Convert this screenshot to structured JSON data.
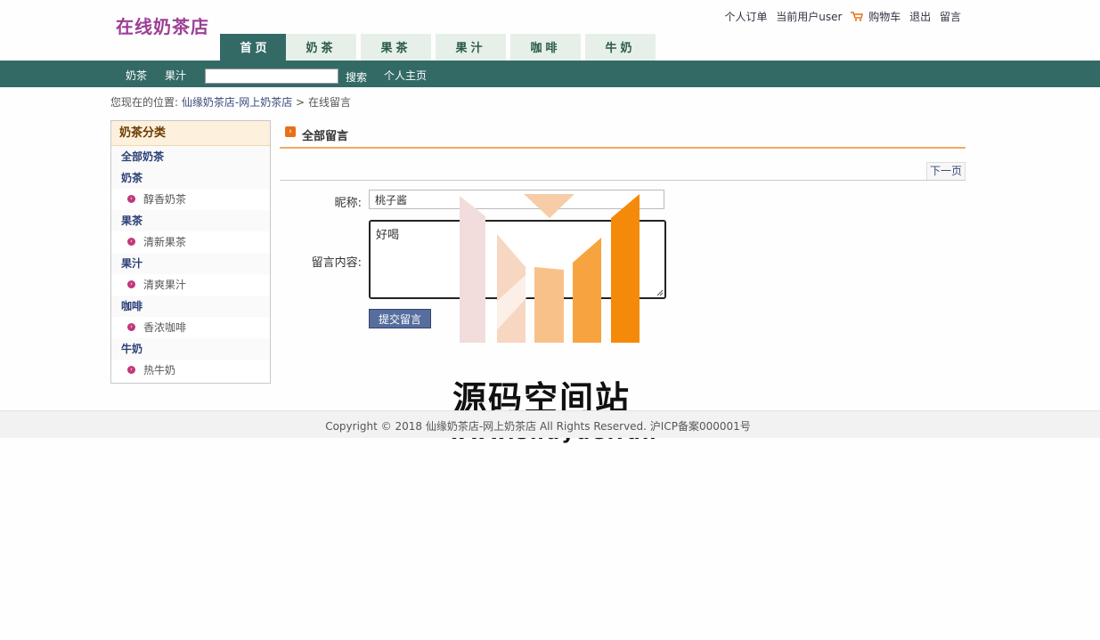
{
  "header": {
    "logo": "在线奶茶店",
    "links": {
      "orders": "个人订单",
      "current_user": "当前用户user",
      "cart": "购物车",
      "logout": "退出",
      "message": "留言"
    }
  },
  "tabs": [
    "首页",
    "奶茶",
    "果茶",
    "果汁",
    "咖啡",
    "牛奶"
  ],
  "active_tab": "首页",
  "nav": {
    "item1": "奶茶",
    "item2": "果汁",
    "search_value": "",
    "search_button": "搜索",
    "home": "个人主页"
  },
  "breadcrumb": {
    "prefix": "您现在的位置:",
    "site": "仙缘奶茶店-网上奶茶店",
    "separator": ">",
    "current": "在线留言"
  },
  "sidebar": {
    "title": "奶茶分类",
    "all": "全部奶茶",
    "groups": [
      {
        "category": "奶茶",
        "item": "醇香奶茶"
      },
      {
        "category": "果茶",
        "item": "清新果茶"
      },
      {
        "category": "果汁",
        "item": "清爽果汁"
      },
      {
        "category": "咖啡",
        "item": "香浓咖啡"
      },
      {
        "category": "牛奶",
        "item": "热牛奶"
      }
    ]
  },
  "main": {
    "title": "全部留言",
    "next_page": "下一页",
    "nickname_label": "昵称:",
    "nickname_value": "桃子酱",
    "content_label": "留言内容:",
    "content_value": "好喝",
    "submit": "提交留言"
  },
  "watermark": {
    "title": "源码空间站",
    "url": "www.shuyue.fun"
  },
  "footer": {
    "text": "Copyright © 2018 仙缘奶茶店-网上奶茶店 All Rights Reserved. 沪ICP备案000001号"
  },
  "colors": {
    "nav_bg": "#336a66",
    "tab_bg": "#e6f0e8",
    "logo": "#9c3f97",
    "accent_orange": "#f3a860"
  }
}
